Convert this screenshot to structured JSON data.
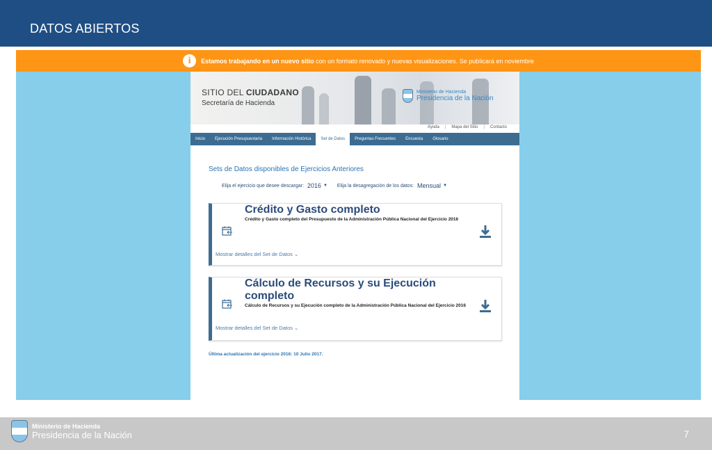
{
  "slide": {
    "title": "DATOS ABIERTOS",
    "page_number": "7"
  },
  "banner": {
    "icon": "info-icon",
    "text_bold": "Estamos trabajando en un nuevo sitio",
    "text_rest": "con un formato renovado y nuevas visualizaciones. Se publicará en noviembre",
    "color": "#ff9514"
  },
  "site": {
    "name_prefix": "SITIO DEL",
    "name_bold": "CIUDADANO",
    "subtitle": "Secretaría de Hacienda",
    "gov_line1": "Ministerio de Hacienda",
    "gov_line2": "Presidencia de la Nación",
    "util_links": [
      "Ayuda",
      "Mapa del Sitio",
      "Contacto"
    ],
    "nav": [
      "Inicio",
      "Ejecución Presupuestaria",
      "Información Histórica",
      "Set de Datos",
      "Preguntas Frecuentes",
      "Encuesta",
      "Glosario"
    ],
    "nav_active": "Set de Datos",
    "sets_title": "Sets de Datos disponibles de Ejercicios Anteriores",
    "filter_year_label": "Elija el ejercicio que desee descargar:",
    "filter_year_value": "2016",
    "filter_period_label": "Elija la desagregación de los datos:",
    "filter_period_value": "Mensual",
    "cards": [
      {
        "title": "Crédito y Gasto completo",
        "description": "Crédito y Gasto completo del Presupuesto de la Administración Pública Nacional del Ejercicio 2016",
        "details": "Mostrar detalles del Set de Datos"
      },
      {
        "title": "Cálculo de Recursos y su Ejecución completo",
        "description": "Cálculo de Recursos y su Ejecución completo de la Administración Pública Nacional del Ejercicio 2016",
        "details": "Mostrar detalles del Set de Datos"
      }
    ],
    "last_update": "Última actualización del ejercicio 2016: 10 Julio 2017."
  },
  "footer": {
    "line1": "Ministerio de Hacienda",
    "line2": "Presidencia de la Nación"
  },
  "colors": {
    "header": "#1f4e85",
    "screenshot_bg": "#87ceea",
    "nav": "#3c6c92",
    "link": "#2a73b3",
    "footer": "#c8c8c8"
  }
}
